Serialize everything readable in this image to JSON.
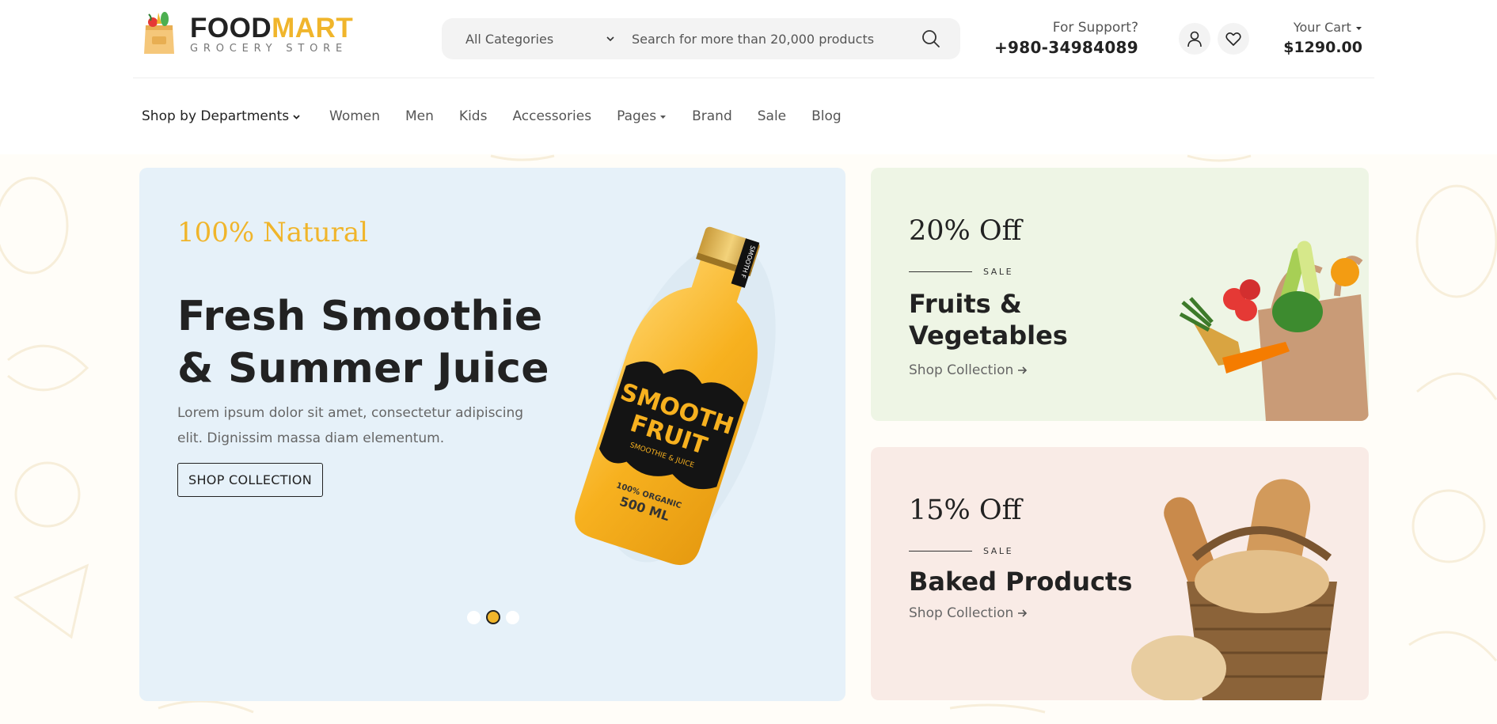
{
  "logo": {
    "title_part1": "FOOD",
    "title_part2": "MART",
    "subtitle": "GROCERY STORE"
  },
  "search": {
    "category": "All Categories",
    "placeholder": "Search for more than 20,000 products"
  },
  "support": {
    "label": "For Support?",
    "phone": "+980-34984089"
  },
  "cart": {
    "label": "Your Cart",
    "total": "$1290.00"
  },
  "nav": {
    "departments": "Shop by Departments",
    "items": [
      {
        "label": "Women"
      },
      {
        "label": "Men"
      },
      {
        "label": "Kids"
      },
      {
        "label": "Accessories"
      },
      {
        "label": "Pages"
      },
      {
        "label": "Brand"
      },
      {
        "label": "Sale"
      },
      {
        "label": "Blog"
      }
    ]
  },
  "banner": {
    "eyebrow": "100% Natural",
    "title": "Fresh Smoothie & Summer Juice",
    "text": "Lorem ipsum dolor sit amet, consectetur adipiscing elit. Dignissim massa diam elementum.",
    "button": "SHOP COLLECTION",
    "bottle_label_1": "SMOOTH",
    "bottle_label_2": "FRUIT",
    "bottle_label_3": "SMOOTHIE & JUICE",
    "bottle_label_4": "100% ORGANIC",
    "bottle_label_5": "500 ML",
    "bottle_cap_text": "SMOOTH F",
    "slides": 3,
    "active_slide": 2
  },
  "cards": [
    {
      "discount": "20% Off",
      "sale": "SALE",
      "title": "Fruits & Vegetables",
      "link": "Shop Collection",
      "bg": "#eef5e5"
    },
    {
      "discount": "15% Off",
      "sale": "SALE",
      "title": "Baked Products",
      "link": "Shop Collection",
      "bg": "#f9ebe6"
    }
  ],
  "colors": {
    "accent": "#f0b52b",
    "text": "#222222",
    "muted": "#666666",
    "banner_bg": "#e6f1f9"
  },
  "icons": {
    "category_select": "chevron-down-icon",
    "search": "search-icon",
    "user": "user-icon",
    "wishlist": "heart-icon",
    "cart_caret": "caret-down-icon",
    "link_arrow": "arrow-right-icon"
  }
}
